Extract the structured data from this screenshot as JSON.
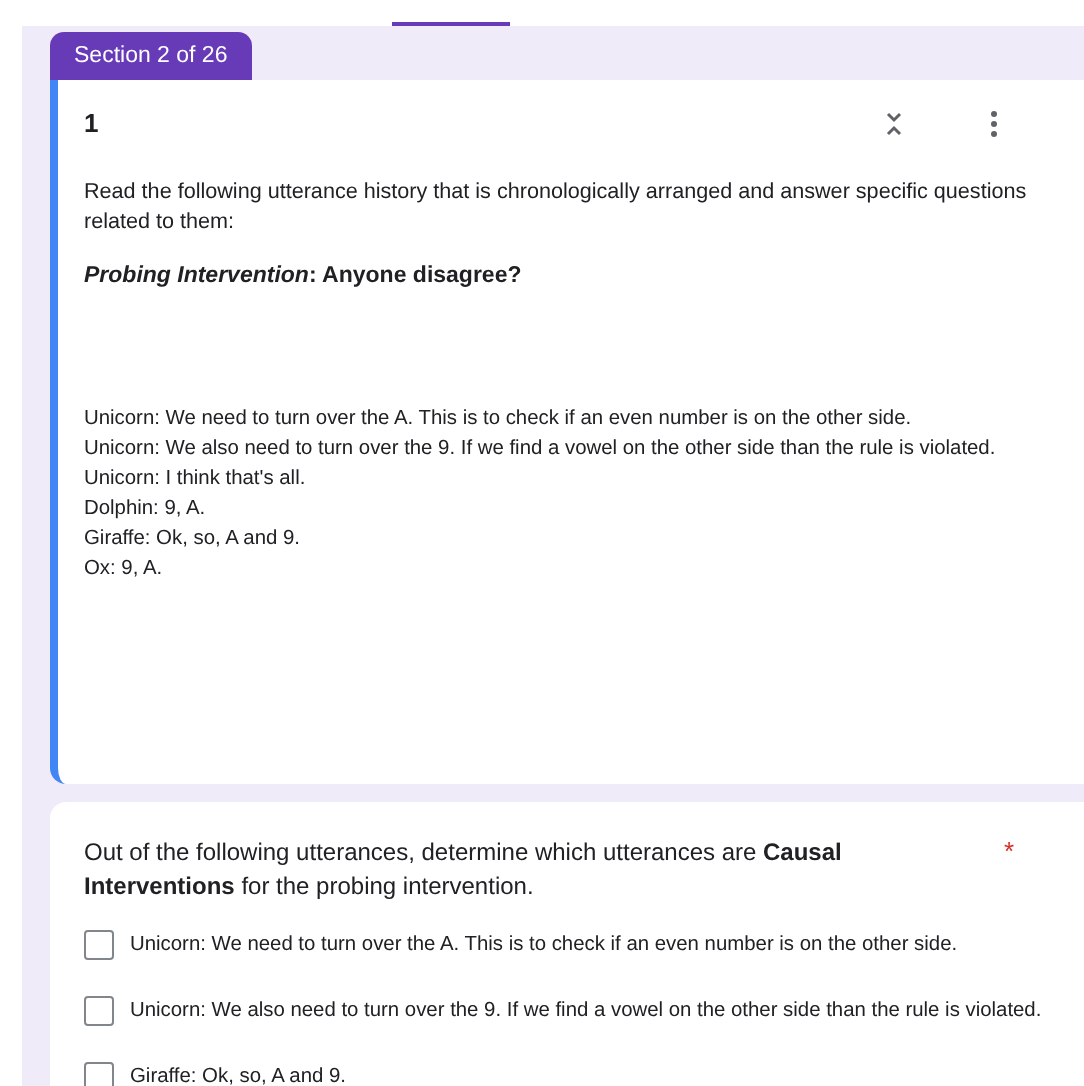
{
  "section_tab": {
    "label": "Section 2 of 26"
  },
  "section_card": {
    "title": "1",
    "description": "Read the following utterance history that is chronologically arranged and answer specific questions related to them:",
    "probe": "*Probing Intervention*: Anyone disagree?",
    "utterances": [
      "Unicorn: We need to turn over the A. This is to check if an even number is on the other side.",
      "Unicorn: We also need to turn over the 9. If we find a vowel on the other side than the rule is violated.",
      "Unicorn: I think that's all.",
      "Dolphin: 9, A.",
      "Giraffe: Ok, so, A and 9.",
      "Ox: 9, A."
    ]
  },
  "question": {
    "text": "Out of the following utterances, determine which utterances are **Causal Interventions** for the probing intervention.",
    "required": true,
    "required_mark": "*",
    "options": [
      {
        "label": "Unicorn: We need to turn over the A. This is to check if an even number is on the other side.",
        "checked": false
      },
      {
        "label": "Unicorn: We also need to turn over the 9. If we find a vowel on the other side than the rule is violated.",
        "checked": false
      },
      {
        "label": "Giraffe: Ok, so, A and 9.",
        "checked": false
      }
    ]
  }
}
